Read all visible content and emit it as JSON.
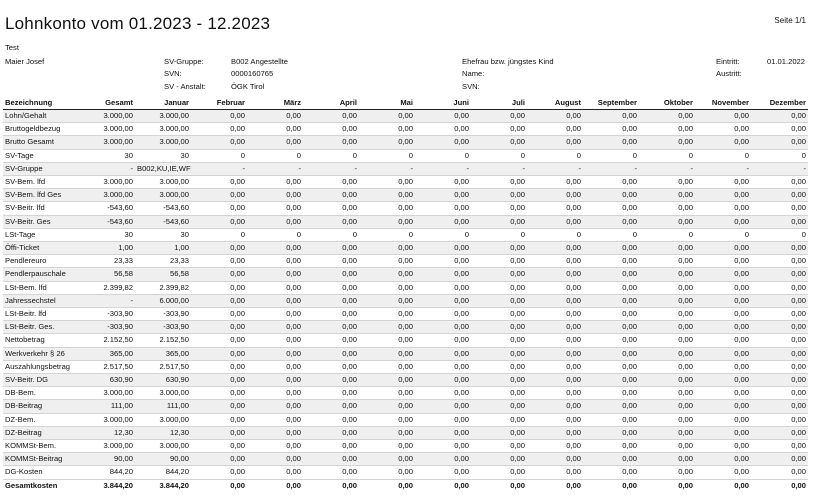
{
  "title": "Lohnkonto vom 01.2023 - 12.2023",
  "page": "Seite 1/1",
  "company": "Test",
  "employee": "Maier Josef",
  "sv": {
    "gruppe_label": "SV-Gruppe:",
    "gruppe_value": "B002  Angestellte",
    "svn_label": "SVN:",
    "svn_value": "0000160765",
    "anstalt_label": "SV - Anstalt:",
    "anstalt_value": "ÖGK Tirol"
  },
  "spouse": {
    "title": "Ehefrau bzw. jüngstes Kind",
    "name_label": "Name:",
    "svn_label": "SVN:"
  },
  "dates": {
    "eintritt_label": "Eintritt:",
    "eintritt_value": "01.01.2022",
    "austritt_label": "Austritt:",
    "austritt_value": ""
  },
  "columns": [
    "Bezeichnung",
    "Gesamt",
    "Januar",
    "Februar",
    "März",
    "April",
    "Mai",
    "Juni",
    "Juli",
    "August",
    "September",
    "Oktober",
    "November",
    "Dezember"
  ],
  "rows": [
    {
      "label": "Lohn/Gehalt",
      "total": "3.000,00",
      "jan": "3.000,00",
      "rest": "0,00"
    },
    {
      "label": "Bruttogeldbezug",
      "total": "3.000,00",
      "jan": "3.000,00",
      "rest": "0,00"
    },
    {
      "label": "Brutto Gesamt",
      "total": "3.000,00",
      "jan": "3.000,00",
      "rest": "0,00"
    },
    {
      "label": "SV-Tage",
      "total": "30",
      "jan": "30",
      "rest": "0"
    },
    {
      "label": "SV-Gruppe",
      "total": "-",
      "jan": "B002,KU,IE,WF",
      "rest": "-"
    },
    {
      "label": "SV-Bem. lfd",
      "total": "3.000,00",
      "jan": "3.000,00",
      "rest": "0,00"
    },
    {
      "label": "SV-Bem. lfd Ges",
      "total": "3.000,00",
      "jan": "3.000,00",
      "rest": "0,00"
    },
    {
      "label": "SV-Beitr. lfd",
      "total": "-543,60",
      "jan": "-543,60",
      "rest": "0,00"
    },
    {
      "label": "SV-Beitr. Ges",
      "total": "-543,60",
      "jan": "-543,60",
      "rest": "0,00"
    },
    {
      "label": "LSt-Tage",
      "total": "30",
      "jan": "30",
      "rest": "0"
    },
    {
      "label": "Öffi-Ticket",
      "total": "1,00",
      "jan": "1,00",
      "rest": "0,00"
    },
    {
      "label": "Pendlereuro",
      "total": "23,33",
      "jan": "23,33",
      "rest": "0,00"
    },
    {
      "label": "Pendlerpauschale",
      "total": "56,58",
      "jan": "56,58",
      "rest": "0,00"
    },
    {
      "label": "LSt-Bem. lfd",
      "total": "2.399,82",
      "jan": "2.399,82",
      "rest": "0,00"
    },
    {
      "label": "Jahressechstel",
      "total": "-",
      "jan": "6.000,00",
      "rest": "0,00"
    },
    {
      "label": "LSt-Beitr. lfd",
      "total": "-303,90",
      "jan": "-303,90",
      "rest": "0,00"
    },
    {
      "label": "LSt-Beitr. Ges.",
      "total": "-303,90",
      "jan": "-303,90",
      "rest": "0,00"
    },
    {
      "label": "Nettobetrag",
      "total": "2.152,50",
      "jan": "2.152,50",
      "rest": "0,00"
    },
    {
      "label": "Werkverkehr § 26",
      "total": "365,00",
      "jan": "365,00",
      "rest": "0,00"
    },
    {
      "label": "Auszahlungsbetrag",
      "total": "2.517,50",
      "jan": "2.517,50",
      "rest": "0,00"
    },
    {
      "label": "SV-Beitr. DG",
      "total": "630,90",
      "jan": "630,90",
      "rest": "0,00"
    },
    {
      "label": "DB-Bem.",
      "total": "3.000,00",
      "jan": "3.000,00",
      "rest": "0,00"
    },
    {
      "label": "DB-Beitrag",
      "total": "111,00",
      "jan": "111,00",
      "rest": "0,00"
    },
    {
      "label": "DZ-Bem.",
      "total": "3.000,00",
      "jan": "3.000,00",
      "rest": "0,00"
    },
    {
      "label": "DZ-Beitrag",
      "total": "12,30",
      "jan": "12,30",
      "rest": "0,00"
    },
    {
      "label": "KOMMSt-Bem.",
      "total": "3.000,00",
      "jan": "3.000,00",
      "rest": "0,00"
    },
    {
      "label": "KOMMSt-Beitrag",
      "total": "90,00",
      "jan": "90,00",
      "rest": "0,00"
    },
    {
      "label": "DG-Kosten",
      "total": "844,20",
      "jan": "844,20",
      "rest": "0,00"
    }
  ],
  "total_row": {
    "label": "Gesamtkosten",
    "total": "3.844,20",
    "jan": "3.844,20",
    "rest": "0,00"
  }
}
